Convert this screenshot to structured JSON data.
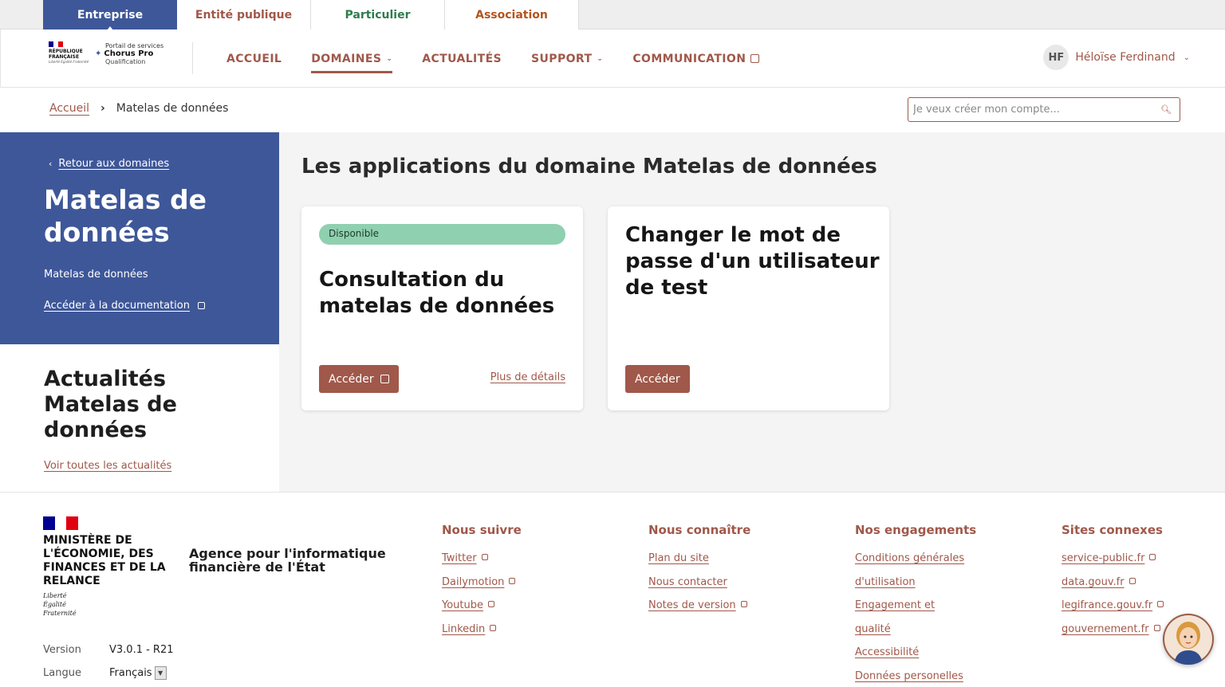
{
  "profile_tabs": [
    "Entreprise",
    "Entité publique",
    "Particulier",
    "Association"
  ],
  "header": {
    "logo_text": "RÉPUBLIQUE FRANÇAISE",
    "logo_motto": "Liberté Égalité Fraternité",
    "portal_sub": "Portail de services",
    "portal_name": "Chorus Pro",
    "portal_env": "Qualification",
    "nav": [
      "ACCUEIL",
      "DOMAINES",
      "ACTUALITÉS",
      "SUPPORT",
      "COMMUNICATION"
    ],
    "user_initials": "HF",
    "user_name": "Héloïse Ferdinand"
  },
  "breadcrumb": {
    "home": "Accueil",
    "current": "Matelas de données"
  },
  "search": {
    "placeholder": "Je veux créer mon compte..."
  },
  "sidebar": {
    "back": "Retour aux domaines",
    "title": "Matelas de données",
    "subtitle": "Matelas de données",
    "doc_link": "Accéder à la documentation",
    "news_title": "Actualités Matelas de données",
    "news_link": "Voir toutes les actualités"
  },
  "main": {
    "title": "Les applications du domaine Matelas de données",
    "cards": [
      {
        "badge": "Disponible",
        "title": "Consultation du matelas de données",
        "button": "Accéder",
        "details": "Plus de détails"
      },
      {
        "title": "Changer le mot de passe d'un utilisateur de test",
        "button": "Accéder"
      }
    ]
  },
  "footer": {
    "ministry": "MINISTÈRE DE L'ÉCONOMIE, DES FINANCES ET DE LA RELANCE",
    "motto": [
      "Liberté",
      "Égalité",
      "Fraternité"
    ],
    "agency": "Agence pour l'informatique financière de l'État",
    "version_label": "Version",
    "version_value": "V3.0.1 - R21",
    "lang_label": "Langue",
    "lang_value": "Français",
    "columns": [
      {
        "title": "Nous suivre",
        "links": [
          "Twitter",
          "Dailymotion",
          "Youtube",
          "Linkedin"
        ]
      },
      {
        "title": "Nous connaître",
        "links": [
          "Plan du site",
          "Nous contacter",
          "Notes de version"
        ]
      },
      {
        "title": "Nos engagements",
        "links": [
          "Conditions générales",
          "d'utilisation",
          "Engagement et",
          "qualité",
          "Accessibilité",
          "Données personelles"
        ]
      },
      {
        "title": "Sites connexes",
        "links": [
          "service-public.fr",
          "data.gouv.fr",
          "legifrance.gouv.fr",
          "gouvernement.fr"
        ]
      }
    ]
  },
  "colors": {
    "blue": "#3e5799",
    "brick": "#a0584a",
    "green_badge": "#8fd0b0",
    "red_flag": "#e1000f"
  }
}
